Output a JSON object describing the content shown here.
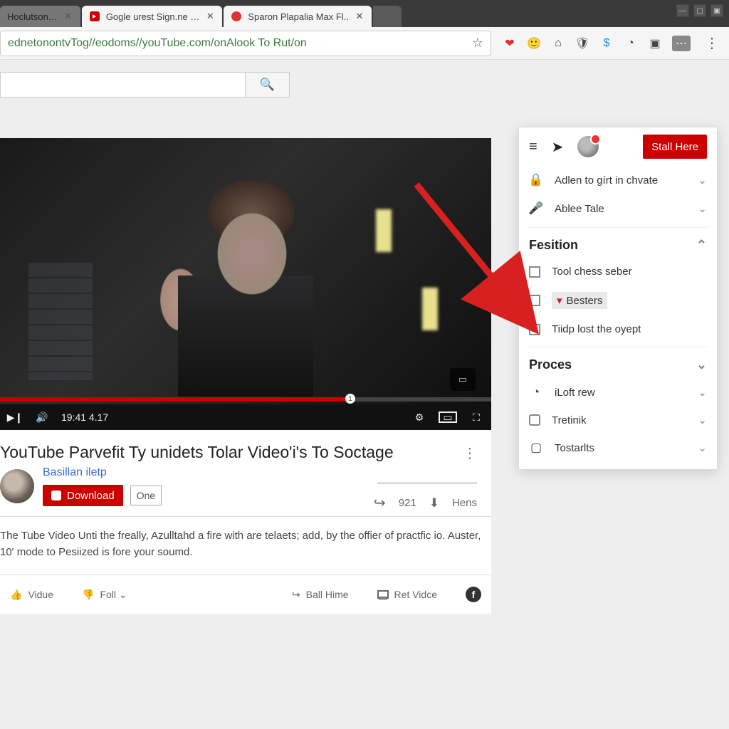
{
  "window": {
    "minimize": "—",
    "maximize": "▢",
    "close": "▣"
  },
  "tabs": [
    {
      "label": "Hoclutson…",
      "favicon": ""
    },
    {
      "label": "Gogle urest Sign.ne …",
      "favicon": "yt"
    },
    {
      "label": "Sparon Plapalia Max Fl..",
      "favicon": "red"
    }
  ],
  "toolbar": {
    "url": "ednetonontvTog//eodoms//youTube.com/onAlook To Rut/on",
    "star": "☆"
  },
  "ext_icons": [
    "❤",
    "🙂",
    "⌂",
    "🛡",
    "$",
    "◔",
    "▣",
    "⋮"
  ],
  "search": {
    "placeholder": "",
    "icon": "🔍"
  },
  "player": {
    "time": "19:41 4.17",
    "cc": "▭",
    "quality": "⚙",
    "theater": "▭",
    "fullscreen": "⛶",
    "play": "▶❙",
    "volume": "🔊",
    "knob": "1"
  },
  "video": {
    "title": "YouTube Parvefit Ty unidets Tolar Video'i's To Soctage",
    "channel": "Basillan iletp",
    "download": "Download",
    "one": "One",
    "share_count": "921",
    "hens": "Hens",
    "desc": "The Tube Video Unti the freally, Azulltahd a fire with are telaets; add, by the offier of practfic io. Auster, 10' mode to Pesiized is fore your soumd."
  },
  "action_bar": {
    "like": "Vidue",
    "dislike": "Foll ⌄",
    "share": "Ball Hime",
    "save": "Ret Vidce",
    "fb": "f"
  },
  "panel": {
    "stall": "Stall Here",
    "row1": "Adlen to gírt in chvate",
    "row2": "Ablee Tale",
    "section1": "Fesition",
    "opt1": "Tool chess seber",
    "opt2": "Besters",
    "opt3": "Tiidp lost the oyept",
    "section2": "Proces",
    "p1": "iLoft rew",
    "p2": "Tretinik",
    "p3": "Tostarlts"
  },
  "icons": {
    "hamburger": "≡",
    "send": "➤",
    "lock": "🔒",
    "mic": "🎤",
    "chev": "⌄",
    "chev_up": "⌃",
    "dots": "⋮",
    "thumbup": "👍",
    "thumbdown": "👎",
    "share": "↪",
    "save": "▭",
    "fb": "f",
    "dl": "▶"
  }
}
